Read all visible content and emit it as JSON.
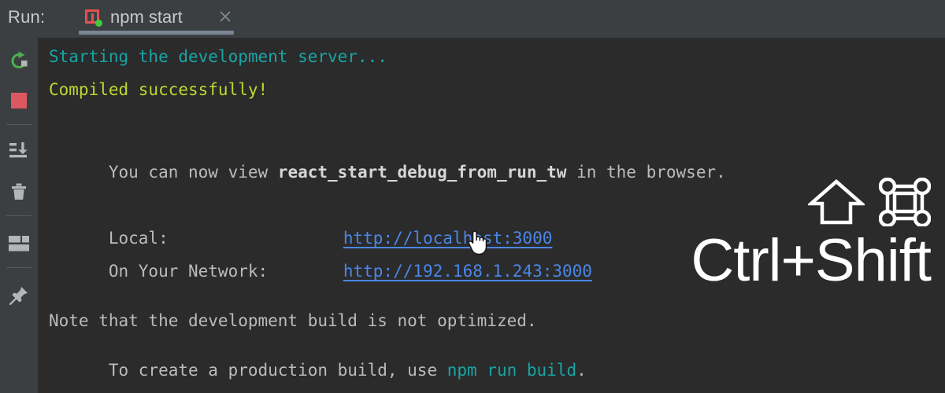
{
  "header": {
    "run_label": "Run:",
    "tab": {
      "title": "npm start",
      "icon": "react-run-config-icon",
      "status": "running",
      "close_icon": "close-icon"
    }
  },
  "toolbar": {
    "items": [
      {
        "name": "rerun-button",
        "icon": "rerun-icon",
        "tooltip": "Rerun"
      },
      {
        "name": "stop-button",
        "icon": "stop-square-icon",
        "tooltip": "Stop"
      },
      {
        "name": "scroll-to-end-button",
        "icon": "scroll-to-end-icon",
        "tooltip": "Scroll to End"
      },
      {
        "name": "clear-all-button",
        "icon": "trash-icon",
        "tooltip": "Clear All"
      },
      {
        "name": "soft-wrap-button",
        "icon": "layout-panes-icon",
        "tooltip": "Soft-Wrap"
      },
      {
        "name": "pin-tab-button",
        "icon": "pin-icon",
        "tooltip": "Pin Tab"
      }
    ]
  },
  "console": {
    "lines": {
      "starting": "Starting the development server...",
      "compiled": "Compiled successfully!",
      "view_pre": "You can now view ",
      "view_app": "react_start_debug_from_run_tw",
      "view_post": " in the browser.",
      "local_label": "Local:",
      "local_url": "http://localhost:3000",
      "network_label": "On Your Network:",
      "network_url": "http://192.168.1.243:3000",
      "note": "Note that the development build is not optimized.",
      "prod_pre": "To create a production build, use ",
      "prod_cmd": "npm run build",
      "prod_post": "."
    },
    "colors": {
      "teal": "#19a5a5",
      "lime": "#c0d731",
      "gray": "#bbbbbb",
      "link": "#4a87e8",
      "background": "#2b2b2b"
    }
  },
  "shortcut_overlay": {
    "shift_symbol": "⇧",
    "command_symbol": "⌘",
    "text": "Ctrl+Shift"
  },
  "cursor": {
    "type": "pointing-hand"
  }
}
